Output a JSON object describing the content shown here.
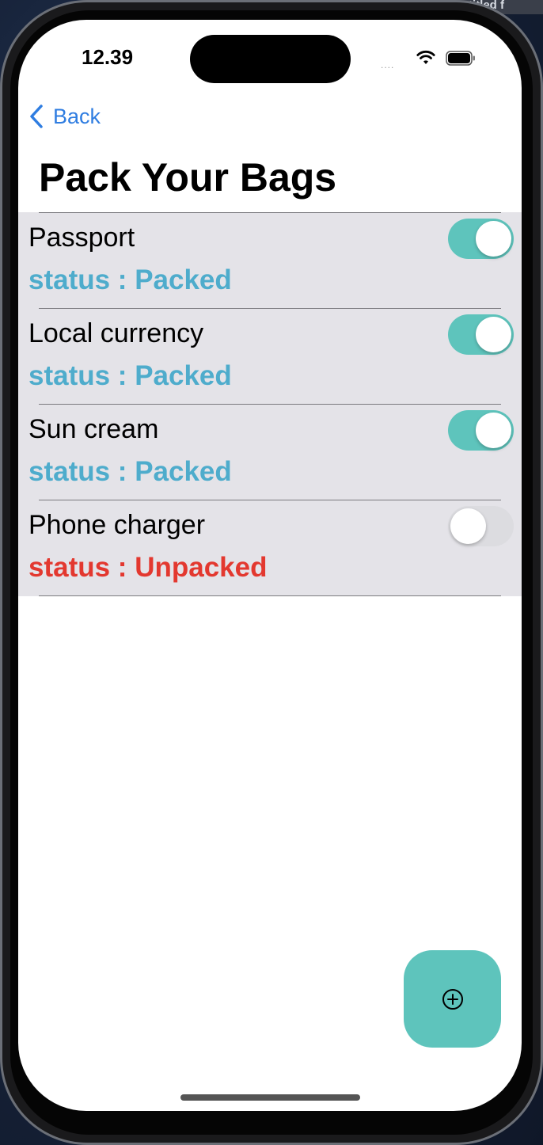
{
  "background_window": {
    "title_fragment": "titled f"
  },
  "status_bar": {
    "time": "12.39",
    "signal_dots": "....",
    "wifi_icon": "wifi-icon",
    "battery_icon": "battery-icon"
  },
  "nav": {
    "back_label": "Back",
    "back_icon": "chevron-left-icon"
  },
  "page": {
    "title": "Pack Your Bags"
  },
  "items": [
    {
      "name": "Passport",
      "status": "status : Packed",
      "packed": true
    },
    {
      "name": "Local currency",
      "status": "status : Packed",
      "packed": true
    },
    {
      "name": "Sun cream",
      "status": "status : Packed",
      "packed": true
    },
    {
      "name": "Phone charger",
      "status": "status : Unpacked",
      "packed": false
    }
  ],
  "fab": {
    "icon": "plus-circle-icon"
  },
  "colors": {
    "accent": "#5ec4bc",
    "packed_text": "#4eaccc",
    "unpacked_text": "#e3382f",
    "toggle_off": "#dcdce0",
    "back_link": "#2f7de1",
    "list_background": "#e4e3e8"
  }
}
